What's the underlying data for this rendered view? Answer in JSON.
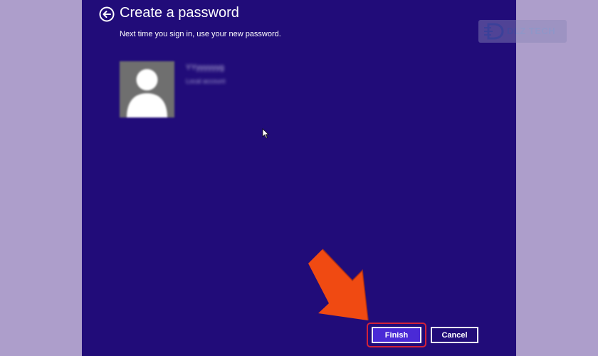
{
  "header": {
    "title": "Create a password",
    "subtitle": "Next time you sign in, use your new password."
  },
  "account": {
    "name": "YYyyyyyyg",
    "type": "Local account",
    "avatar_icon": "user-silhouette-icon"
  },
  "buttons": {
    "finish_label": "Finish",
    "cancel_label": "Cancel"
  },
  "watermark": {
    "text": "DLZ TECH"
  },
  "colors": {
    "background": "#ad9ecb",
    "panel": "#210c79",
    "finish_button": "#4a2ad6",
    "highlight": "#d2223a",
    "arrow": "#f04a12"
  }
}
